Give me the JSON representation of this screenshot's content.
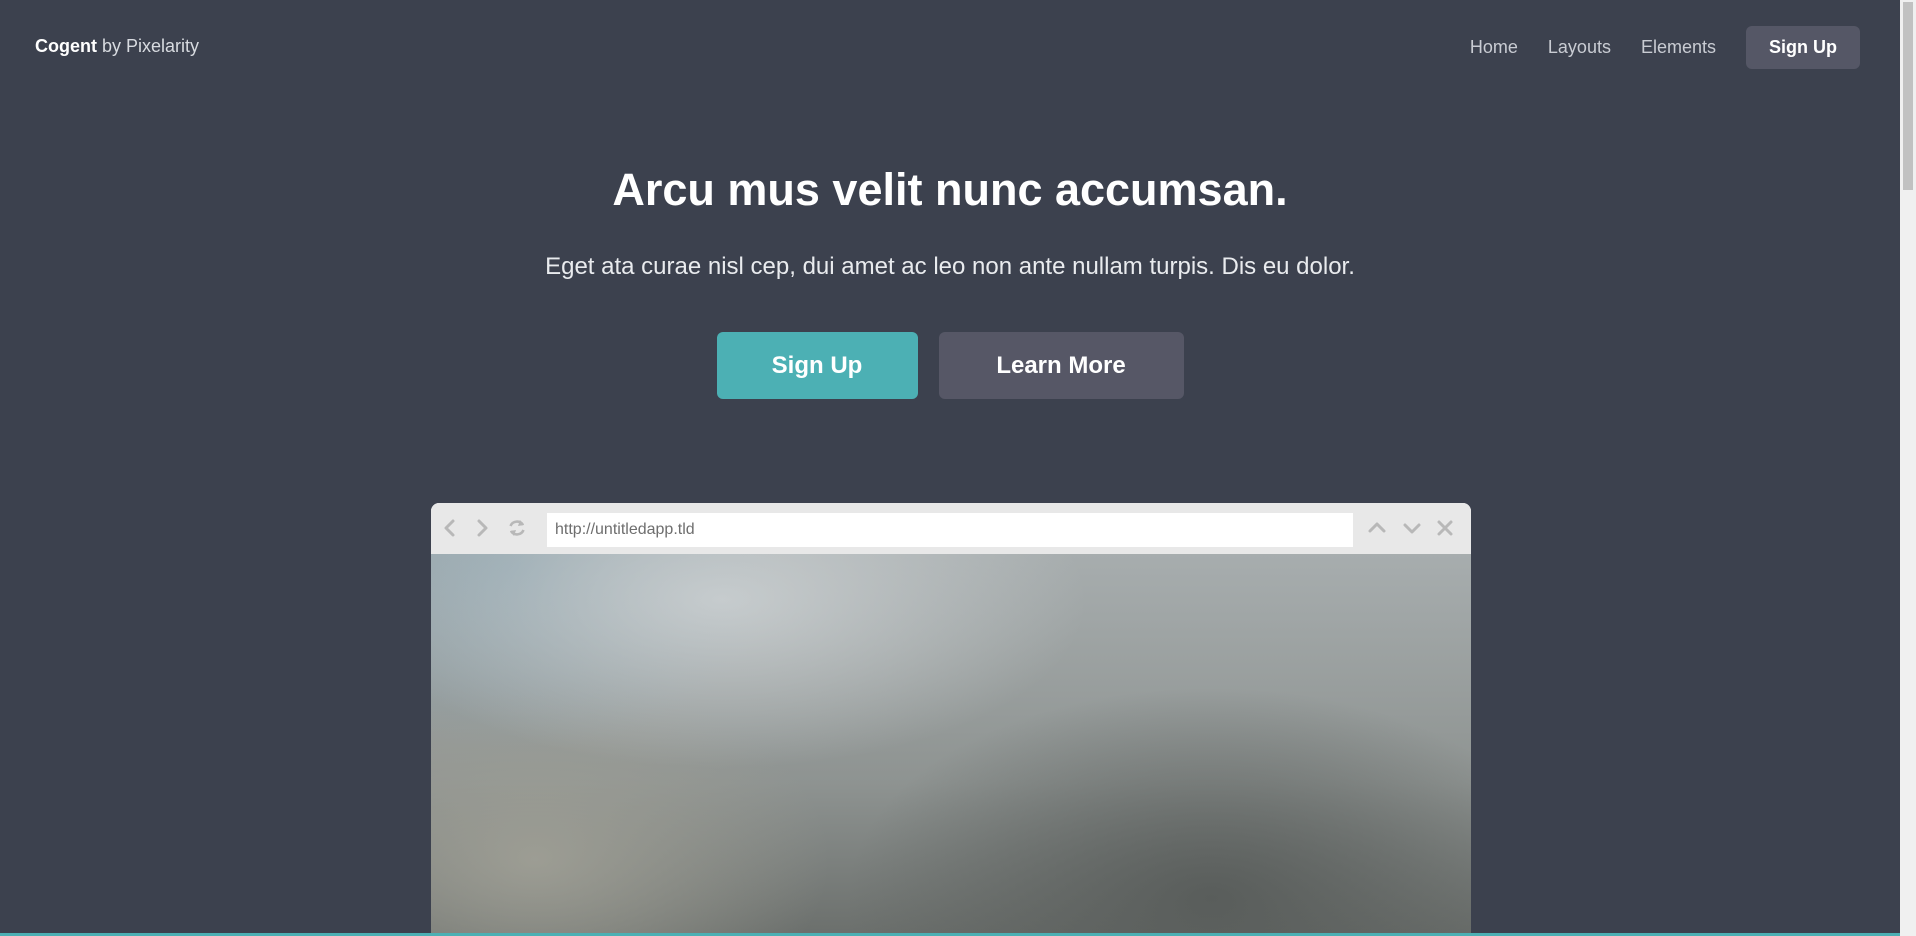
{
  "header": {
    "logo_strong": "Cogent",
    "logo_rest": "by Pixelarity",
    "nav": [
      {
        "label": "Home"
      },
      {
        "label": "Layouts"
      },
      {
        "label": "Elements"
      }
    ],
    "signup_label": "Sign Up"
  },
  "hero": {
    "title": "Arcu mus velit nunc accumsan.",
    "subtitle": "Eget ata curae nisl cep, dui amet ac leo non ante nullam turpis. Dis eu dolor.",
    "primary_button": "Sign Up",
    "secondary_button": "Learn More"
  },
  "browser": {
    "url": "http://untitledapp.tld",
    "icons": [
      "back-icon",
      "forward-icon",
      "refresh-icon",
      "up-icon",
      "down-icon",
      "close-icon"
    ]
  },
  "colors": {
    "background": "#3c414e",
    "accent": "#4cb0b4",
    "secondary_button": "#565766"
  }
}
